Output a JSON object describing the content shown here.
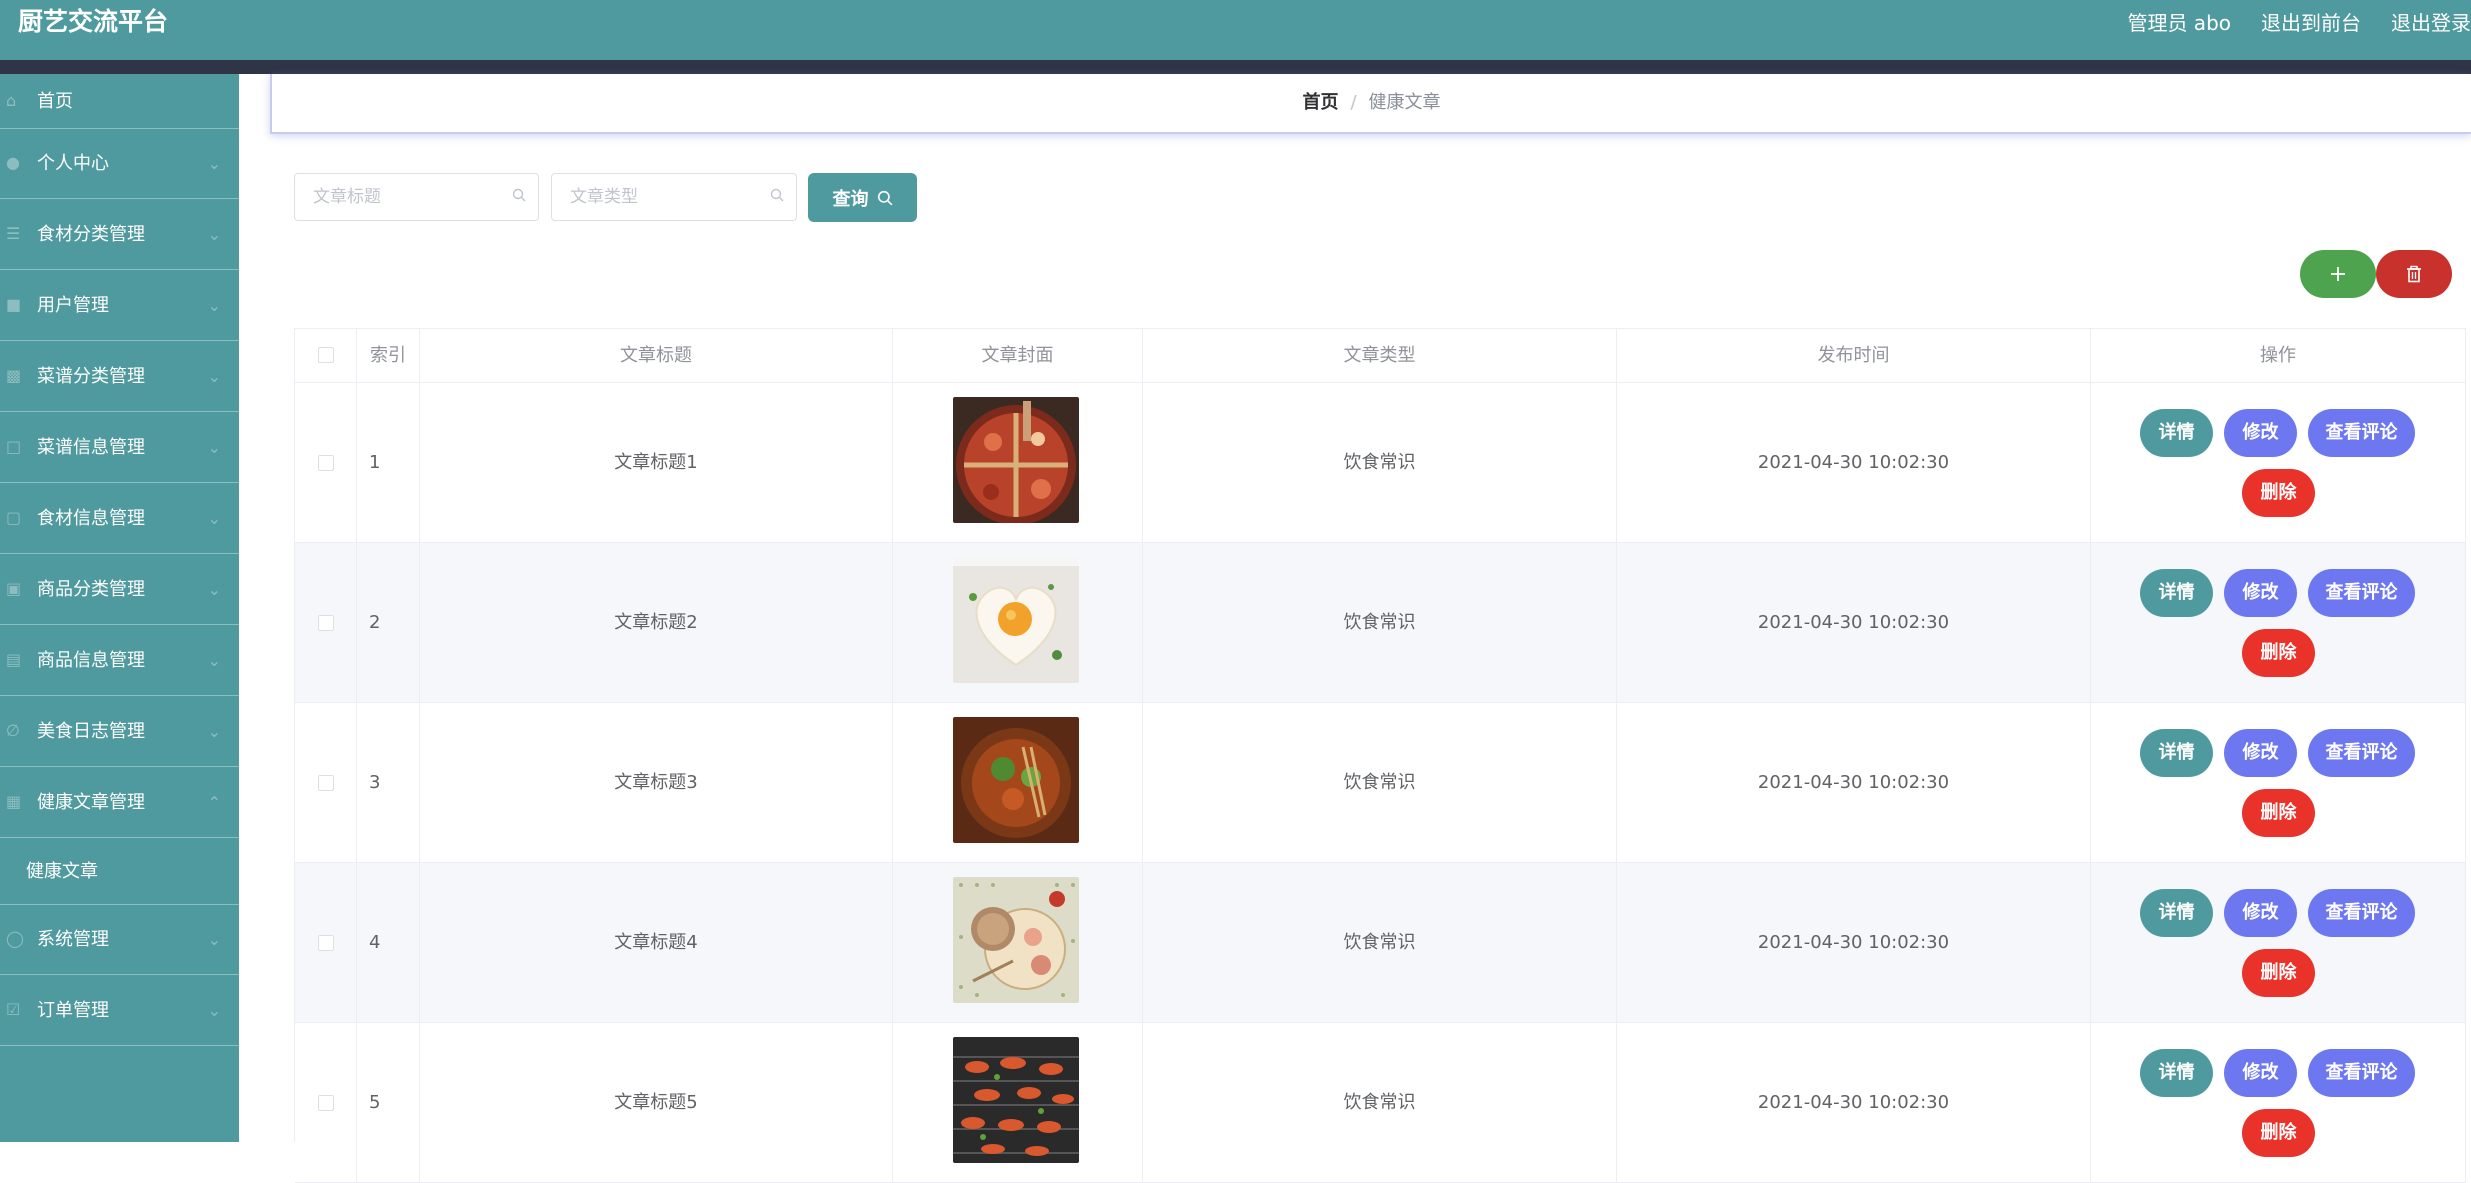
{
  "header": {
    "brand": "厨艺交流平台",
    "admin": "管理员 abo",
    "to_front": "退出到前台",
    "logout": "退出登录"
  },
  "sidebar": {
    "items": [
      {
        "label": "首页",
        "icon": "home-icon"
      },
      {
        "label": "个人中心",
        "icon": "user-icon"
      },
      {
        "label": "食材分类管理",
        "icon": "list-icon"
      },
      {
        "label": "用户管理",
        "icon": "users-icon"
      },
      {
        "label": "菜谱分类管理",
        "icon": "chart-icon"
      },
      {
        "label": "菜谱信息管理",
        "icon": "book-icon"
      },
      {
        "label": "食材信息管理",
        "icon": "box-icon"
      },
      {
        "label": "商品分类管理",
        "icon": "shop-icon"
      },
      {
        "label": "商品信息管理",
        "icon": "goods-icon"
      },
      {
        "label": "美食日志管理",
        "icon": "note-icon"
      },
      {
        "label": "健康文章管理",
        "icon": "article-icon"
      },
      {
        "label": "健康文章",
        "sub": true
      },
      {
        "label": "系统管理",
        "icon": "settings-icon"
      },
      {
        "label": "订单管理",
        "icon": "order-icon"
      }
    ]
  },
  "breadcrumb": {
    "home": "首页",
    "separator": "/",
    "current": "健康文章"
  },
  "search": {
    "title_placeholder": "文章标题",
    "type_placeholder": "文章类型",
    "query_label": "查询"
  },
  "actions": {
    "add_icon": "plus-icon",
    "delete_icon": "trash-icon"
  },
  "table": {
    "columns": [
      "索引",
      "文章标题",
      "文章封面",
      "文章类型",
      "发布时间",
      "操作"
    ],
    "op_labels": {
      "detail": "详情",
      "edit": "修改",
      "comment": "查看评论",
      "delete": "删除"
    },
    "rows": [
      {
        "index": "1",
        "title": "文章标题1",
        "type": "饮食常识",
        "time": "2021-04-30 10:02:30"
      },
      {
        "index": "2",
        "title": "文章标题2",
        "type": "饮食常识",
        "time": "2021-04-30 10:02:30"
      },
      {
        "index": "3",
        "title": "文章标题3",
        "type": "饮食常识",
        "time": "2021-04-30 10:02:30"
      },
      {
        "index": "4",
        "title": "文章标题4",
        "type": "饮食常识",
        "time": "2021-04-30 10:02:30"
      },
      {
        "index": "5",
        "title": "文章标题5",
        "type": "饮食常识",
        "time": "2021-04-30 10:02:30"
      }
    ]
  },
  "colors": {
    "primary": "#4f9a9e",
    "accent": "#6c77f0",
    "danger": "#e8322a",
    "success": "#4ea34e",
    "dark": "#2f3447"
  }
}
